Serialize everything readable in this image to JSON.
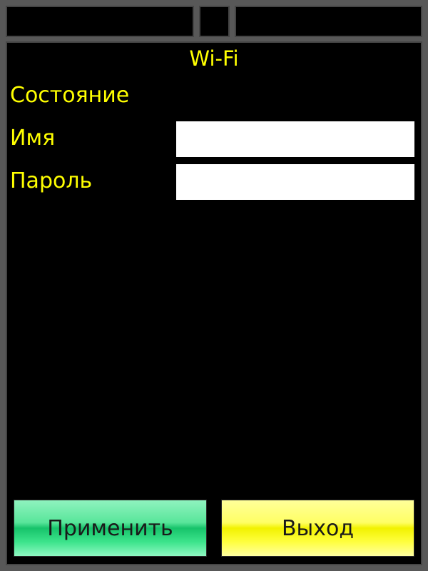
{
  "screen": {
    "title": "Wi-Fi"
  },
  "form": {
    "status_label": "Состояние",
    "name_label": "Имя",
    "name_value": "",
    "password_label": "Пароль",
    "password_value": ""
  },
  "buttons": {
    "apply_label": "Применить",
    "exit_label": "Выход"
  },
  "colors": {
    "background": "#000000",
    "frame": "#585858",
    "text": "#ffff00",
    "apply_button": "#3de48c",
    "exit_button": "#ffff40"
  }
}
